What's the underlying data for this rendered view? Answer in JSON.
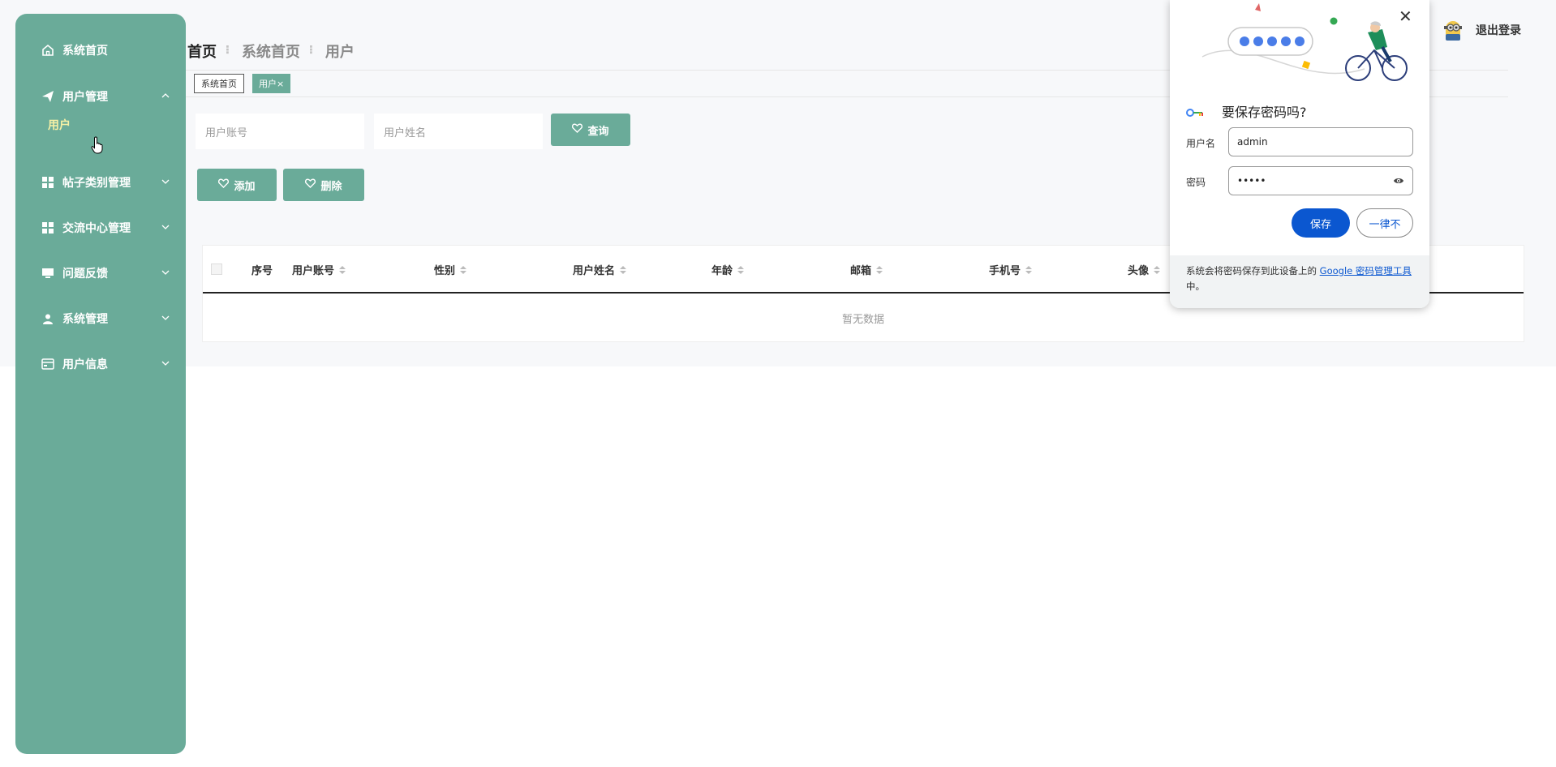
{
  "sidebar": {
    "items": [
      {
        "label": "系统首页",
        "icon": "home-icon"
      },
      {
        "label": "用户管理",
        "icon": "send-icon",
        "expanded": true
      },
      {
        "label": "帖子类别管理",
        "icon": "grid-icon"
      },
      {
        "label": "交流中心管理",
        "icon": "grid-icon"
      },
      {
        "label": "问题反馈",
        "icon": "monitor-icon"
      },
      {
        "label": "系统管理",
        "icon": "user-icon"
      },
      {
        "label": "用户信息",
        "icon": "card-icon"
      }
    ],
    "sub_item": "用户"
  },
  "breadcrumb": {
    "first": "首页",
    "second": "系统首页",
    "third": "用户"
  },
  "tags": {
    "home": "系统首页",
    "current": "用户×"
  },
  "search": {
    "account_placeholder": "用户账号",
    "name_placeholder": "用户姓名",
    "query_label": "查询"
  },
  "actions": {
    "add_label": "添加",
    "delete_label": "删除"
  },
  "table": {
    "headers": [
      "序号",
      "用户账号",
      "性别",
      "用户姓名",
      "年龄",
      "邮箱",
      "手机号",
      "头像"
    ],
    "empty_text": "暂无数据"
  },
  "header": {
    "logout_label": "退出登录"
  },
  "password_popup": {
    "title": "要保存密码吗?",
    "username_label": "用户名",
    "username_value": "admin",
    "password_label": "密码",
    "password_value": "•••••",
    "save_label": "保存",
    "never_label": "一律不",
    "footer_text": "系统会将密码保存到此设备上的",
    "footer_link": "Google 密码管理工具",
    "footer_suffix": "中。"
  },
  "colors": {
    "sidebar": "#6aab99",
    "accent_text": "#f5f0a6",
    "primary_blue": "#0b57d0"
  }
}
